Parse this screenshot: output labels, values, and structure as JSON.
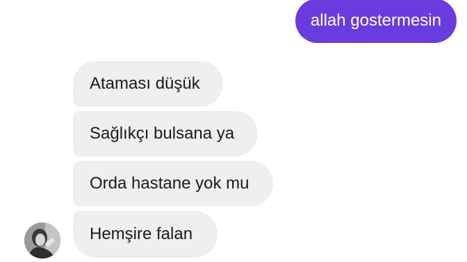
{
  "messages": {
    "sent": [
      {
        "text": "allah gostermesin"
      }
    ],
    "received": [
      {
        "text": "Ataması düşük"
      },
      {
        "text": "Sağlıkçı bulsana ya"
      },
      {
        "text": "Orda hastane yok mu"
      },
      {
        "text": "Hemşire falan"
      }
    ]
  },
  "colors": {
    "sent_bubble": "#6a3bdf",
    "received_bubble": "#efefef"
  },
  "icons": {
    "avatar": "contact-avatar-photo"
  }
}
